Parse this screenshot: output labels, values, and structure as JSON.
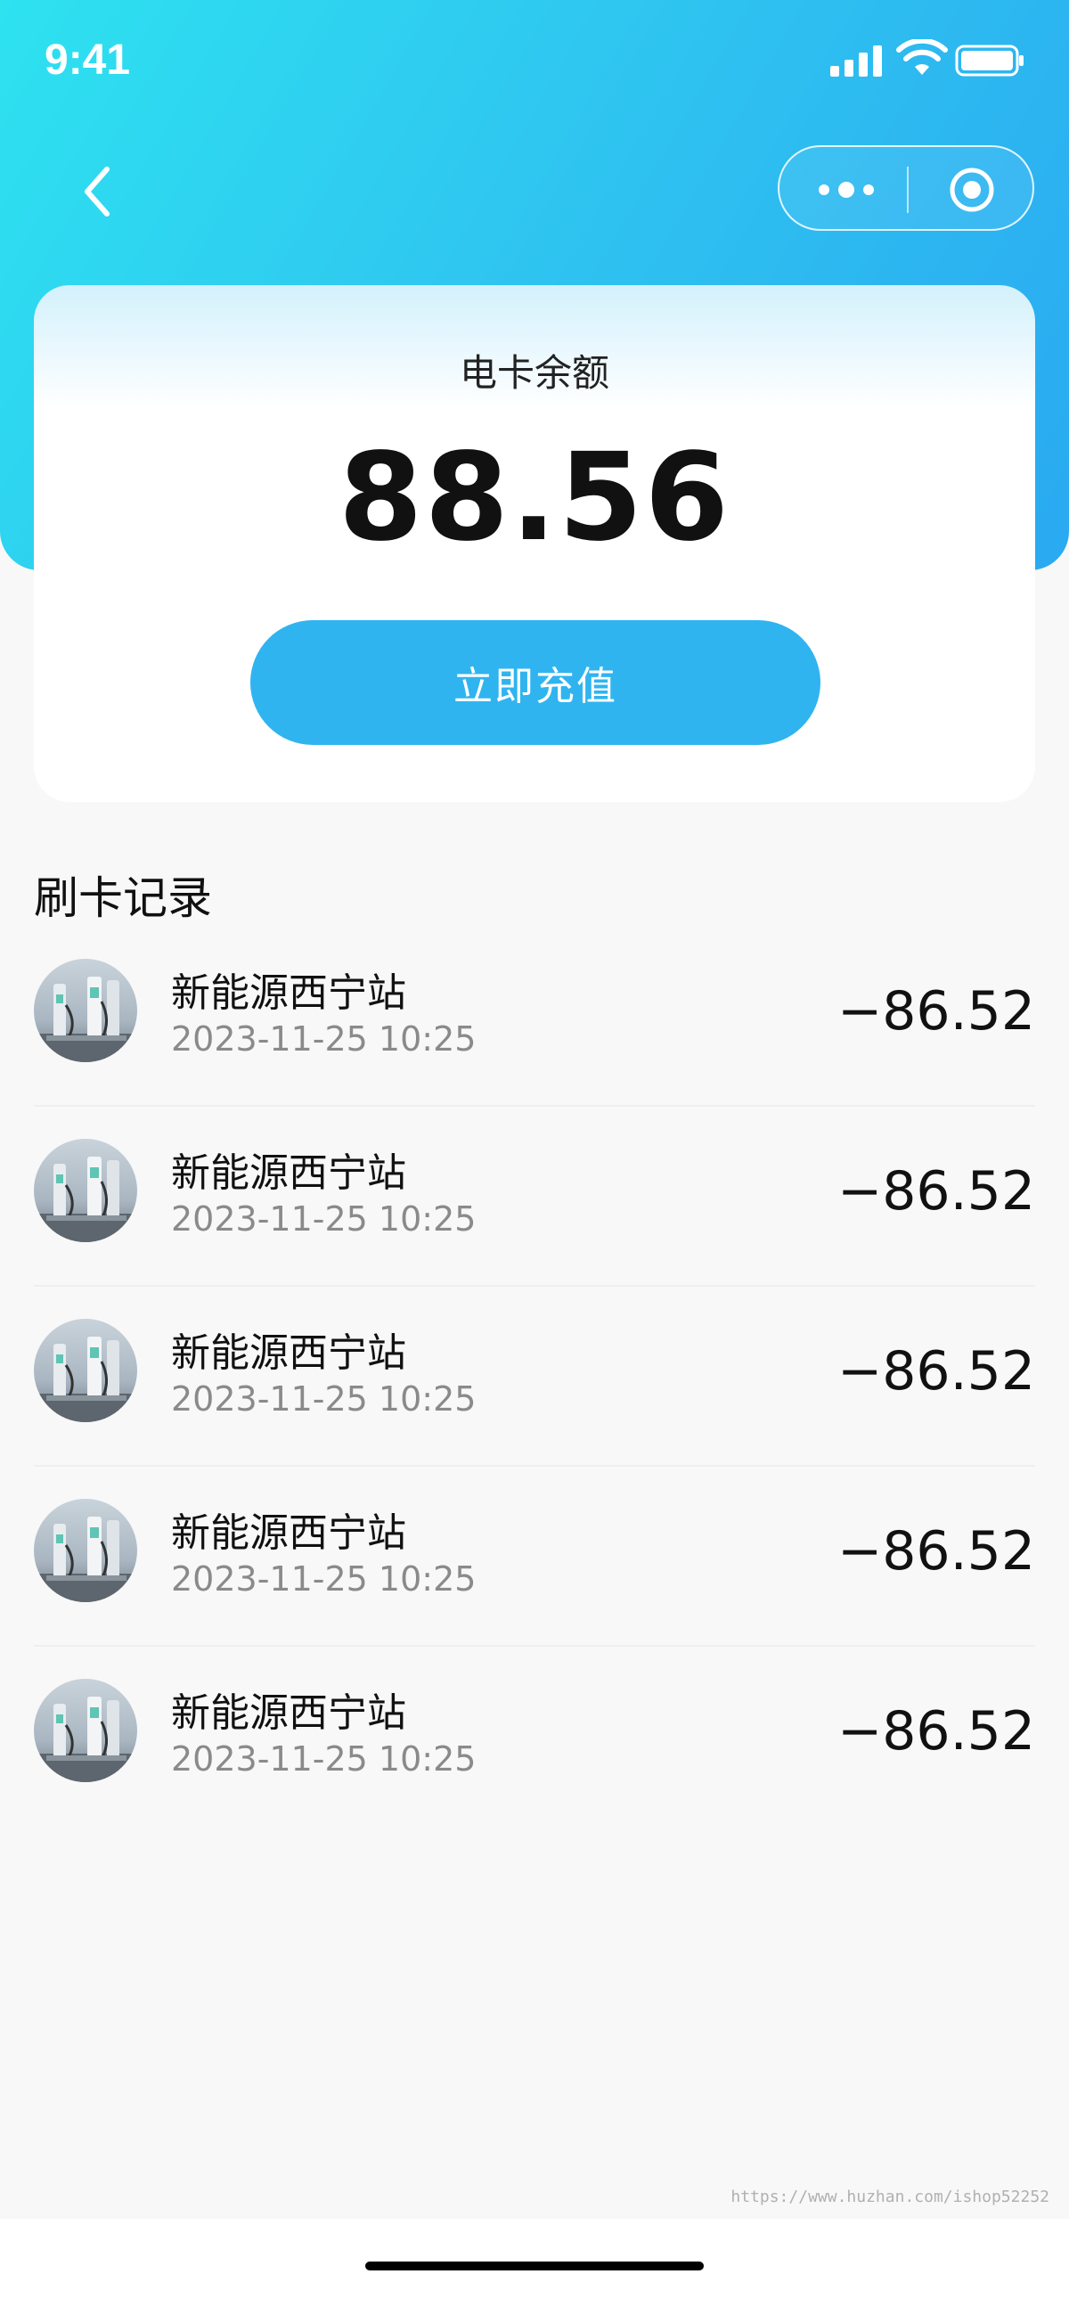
{
  "status_bar": {
    "time": "9:41"
  },
  "colors": {
    "accent": "#2fb4f0",
    "header_start": "#2ee2f0",
    "header_end": "#2aa9f1"
  },
  "nav": {
    "back_icon": "chevron-left-icon",
    "more_icon": "more-dots-icon",
    "close_icon": "target-circle-icon"
  },
  "balance_card": {
    "label": "电卡余额",
    "value": "88.56",
    "recharge_label": "立即充值"
  },
  "records": {
    "title": "刷卡记录",
    "items": [
      {
        "name": "新能源西宁站",
        "time": "2023-11-25 10:25",
        "amount": "−86.52"
      },
      {
        "name": "新能源西宁站",
        "time": "2023-11-25 10:25",
        "amount": "−86.52"
      },
      {
        "name": "新能源西宁站",
        "time": "2023-11-25 10:25",
        "amount": "−86.52"
      },
      {
        "name": "新能源西宁站",
        "time": "2023-11-25 10:25",
        "amount": "−86.52"
      },
      {
        "name": "新能源西宁站",
        "time": "2023-11-25 10:25",
        "amount": "−86.52"
      }
    ]
  },
  "watermark": "https://www.huzhan.com/ishop52252"
}
